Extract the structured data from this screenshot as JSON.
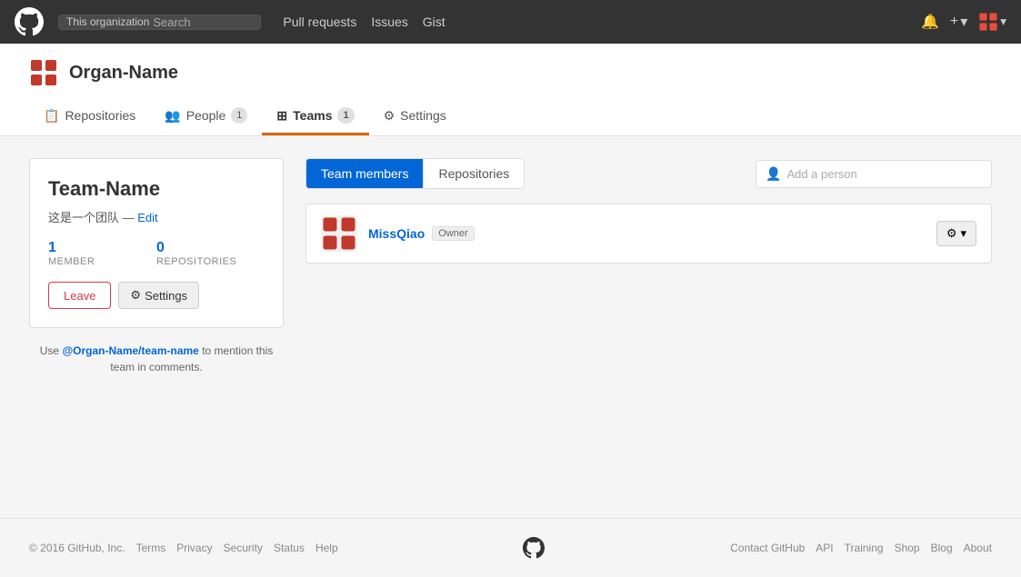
{
  "nav": {
    "org_label": "This organization",
    "search_placeholder": "Search",
    "links": [
      "Pull requests",
      "Issues",
      "Gist"
    ],
    "new_label": "+",
    "notification_icon": "bell-icon",
    "plus_icon": "plus-icon",
    "grid_icon": "grid-icon"
  },
  "org": {
    "name": "Organ-Name",
    "tabs": [
      {
        "id": "repositories",
        "icon": "repo-icon",
        "label": "Repositories",
        "badge": null,
        "active": false
      },
      {
        "id": "people",
        "icon": "people-icon",
        "label": "People",
        "badge": "1",
        "active": false
      },
      {
        "id": "teams",
        "icon": "teams-icon",
        "label": "Teams",
        "badge": "1",
        "active": true
      },
      {
        "id": "settings",
        "icon": "gear-icon",
        "label": "Settings",
        "badge": null,
        "active": false
      }
    ]
  },
  "team": {
    "name": "Team-Name",
    "description": "这是一个团队",
    "edit_label": "Edit",
    "member_count": "1",
    "member_label": "MEMBER",
    "repo_count": "0",
    "repo_label": "REPOSITORIES",
    "leave_label": "Leave",
    "settings_label": "Settings",
    "mention_prefix": "Use",
    "mention_handle": "@Organ-Name/team-name",
    "mention_suffix": "to mention this team in comments."
  },
  "team_panel": {
    "tab_members": "Team members",
    "tab_repos": "Repositories",
    "add_person_placeholder": "Add a person",
    "members": [
      {
        "username": "MissQiao",
        "role": "Owner",
        "avatar_color": "#c0392b"
      }
    ]
  },
  "footer": {
    "copyright": "© 2016 GitHub, Inc.",
    "links_left": [
      "Terms",
      "Privacy",
      "Security",
      "Status",
      "Help"
    ],
    "links_right": [
      "Contact GitHub",
      "API",
      "Training",
      "Shop",
      "Blog",
      "About"
    ]
  }
}
